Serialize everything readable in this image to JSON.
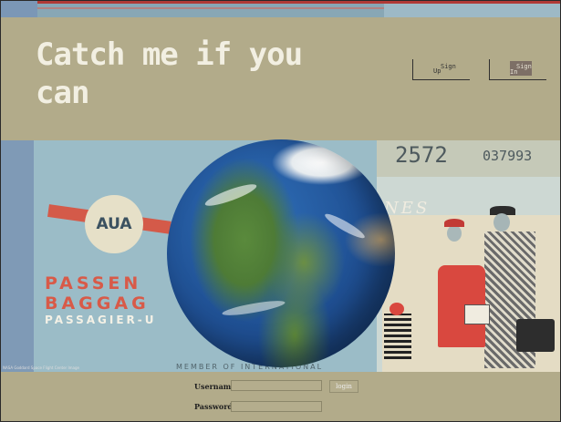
{
  "header": {
    "title": "Catch me if you can",
    "signup": {
      "label": "Sign",
      "sublabel": "Up"
    },
    "signin": {
      "label": "Sign",
      "sublabel": "In"
    }
  },
  "hero": {
    "ticket_number": "2572",
    "serial_number": "037993",
    "airline_logo": "AUA",
    "passenger_line1": "PASSEN",
    "passenger_line2": "BAGGAG",
    "passagier": "PASSAGIER-U",
    "partial_text": "NES",
    "member_text": "MEMBER OF INTERNATIONAL",
    "caption": "NASA Goddard Space Flight Center Image"
  },
  "login": {
    "username_label": "Username:",
    "password_label": "Password:",
    "username_value": "",
    "password_value": "",
    "login_button": "login"
  }
}
